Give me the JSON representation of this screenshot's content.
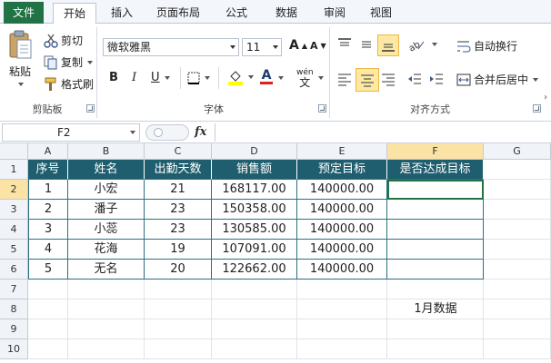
{
  "tabs": [
    "文件",
    "开始",
    "插入",
    "页面布局",
    "公式",
    "数据",
    "审阅",
    "视图"
  ],
  "clipboard": {
    "paste": "粘贴",
    "cut": "剪切",
    "copy": "复制",
    "format_painter": "格式刷",
    "group": "剪贴板"
  },
  "font": {
    "name": "微软雅黑",
    "size": "11",
    "bold": "B",
    "italic": "I",
    "underline": "U",
    "grow": "A",
    "shrink": "A",
    "font_color": "A",
    "phonetic": "wén",
    "group": "字体"
  },
  "alignment": {
    "wrap_text": "自动换行",
    "merge_center": "合并后居中",
    "group": "对齐方式"
  },
  "formula_bar": {
    "name_box": "F2",
    "fx": "fx",
    "content": ""
  },
  "grid": {
    "columns": [
      "A",
      "B",
      "C",
      "D",
      "E",
      "F",
      "G"
    ],
    "rows": [
      "1",
      "2",
      "3",
      "4",
      "5",
      "6",
      "7",
      "8",
      "9",
      "10"
    ],
    "headers": [
      "序号",
      "姓名",
      "出勤天数",
      "销售额",
      "预定目标",
      "是否达成目标"
    ],
    "data": [
      [
        "1",
        "小宏",
        "21",
        "168117.00",
        "140000.00",
        ""
      ],
      [
        "2",
        "潘子",
        "23",
        "150358.00",
        "140000.00",
        ""
      ],
      [
        "3",
        "小蕊",
        "23",
        "130585.00",
        "140000.00",
        ""
      ],
      [
        "4",
        "花海",
        "19",
        "107091.00",
        "140000.00",
        ""
      ],
      [
        "5",
        "无名",
        "20",
        "122662.00",
        "140000.00",
        ""
      ]
    ],
    "note": "1月数据"
  },
  "colors": {
    "header_fill": "#1f5e6e",
    "border": "#2c6f80",
    "file_tab": "#217346",
    "selection": "#fde9a4"
  }
}
